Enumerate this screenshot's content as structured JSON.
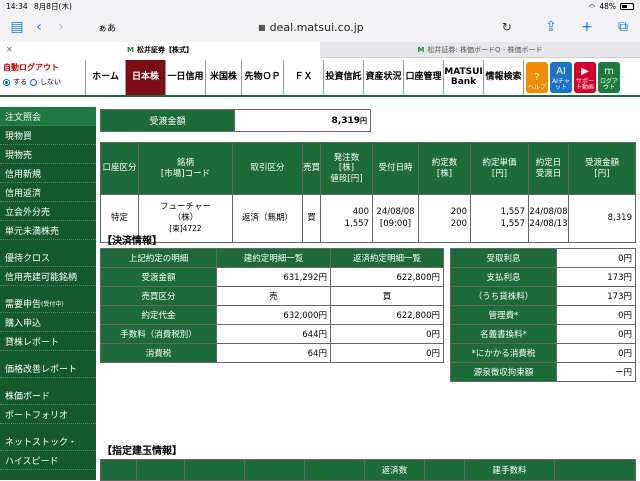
{
  "status": {
    "time": "14:34",
    "date": "8月8日(木)",
    "battery": "48%"
  },
  "browser": {
    "aa": "ぁあ",
    "url": "deal.matsui.co.jp",
    "tab_active": "松井証券【株式】",
    "tab_inactive": "松井証券: 株価ボードQ - 株価ボード"
  },
  "nav": {
    "autologout_title": "自動ログアウト",
    "opt_on": "する",
    "opt_off": "しない",
    "items": [
      "ホーム",
      "日本株",
      "一日信用",
      "米国株",
      "先物ＯＰ",
      "ＦＸ",
      "投資信託",
      "資産状況",
      "口座管理",
      "MATSUI Bank",
      "情報検索"
    ],
    "icons": [
      {
        "label": "ヘルプ",
        "glyph": "?",
        "color": "#f28c00"
      },
      {
        "label": "AIチャット",
        "glyph": "AI",
        "color": "#1a73c9"
      },
      {
        "label": "サポート動画",
        "glyph": "▶",
        "color": "#d4002a"
      },
      {
        "label": "ログアウト",
        "glyph": "m",
        "color": "#1e7a3e"
      }
    ]
  },
  "sidebar": {
    "group1": [
      "注文照会",
      "現物買",
      "現物売",
      "信用新規",
      "信用返済",
      "立会外分売",
      "単元未満株売"
    ],
    "group2": [
      "優待クロス",
      "信用売建可能銘柄"
    ],
    "group3a": "需要申告",
    "group3a_note": "(受付中)",
    "group3": [
      "購入申込",
      "貸株レポート"
    ],
    "group4": [
      "価格改善レポート"
    ],
    "group5": [
      "株価ボード",
      "ポートフォリオ"
    ],
    "group6": [
      "ネットストック・",
      "ハイスピード"
    ]
  },
  "receive": {
    "label": "受渡金額",
    "value": "8,319",
    "unit": "円"
  },
  "order": {
    "headers": [
      "口座区分",
      "銘柄\n[市場]コード",
      "取引区分",
      "売買",
      "発注数\n[株]\n値段[円]",
      "受付日時",
      "約定数\n[株]",
      "約定単価\n[円]",
      "約定日\n受渡日",
      "受渡金額\n[円]"
    ],
    "row": {
      "account": "特定",
      "name": "フューチャー\n（株）",
      "code": "[東]4722",
      "trade": "返済（無期）",
      "side": "買",
      "qty": "400\n1,557",
      "accepted": "24/08/08\n[09:00]",
      "exec_qty": "200\n200",
      "exec_price": "1,557\n1,557",
      "dates": "24/08/08\n24/08/13",
      "amount": "8,319"
    }
  },
  "settle": {
    "title": "【決済情報】",
    "head": [
      "上記約定の明細",
      "建約定明細一覧",
      "返済約定明細一覧"
    ],
    "rows": [
      {
        "label": "受渡金額",
        "a": "631,292円",
        "b": "622,800円"
      },
      {
        "label": "売買区分",
        "a": "売",
        "b": "買"
      },
      {
        "label": "約定代金",
        "a": "632,000円",
        "b": "622,800円"
      },
      {
        "label": "手数料（消費税別）",
        "a": "644円",
        "b": "0円"
      },
      {
        "label": "消費税",
        "a": "64円",
        "b": "0円"
      }
    ]
  },
  "interest": [
    {
      "label": "受取利息",
      "value": "0円"
    },
    {
      "label": "支払利息",
      "value": "173円"
    },
    {
      "label": "（うち貸株料）",
      "value": "173円"
    },
    {
      "label": "管理費*",
      "value": "0円"
    },
    {
      "label": "名義書換料*",
      "value": "0円"
    },
    {
      "label": "*にかかる消費税",
      "value": "0円"
    },
    {
      "label": "源泉徴収拘束額",
      "value": "ー円"
    }
  ],
  "position": {
    "title": "【指定建玉情報】",
    "head_qty": "返済数",
    "head_fee": "建手数料"
  }
}
